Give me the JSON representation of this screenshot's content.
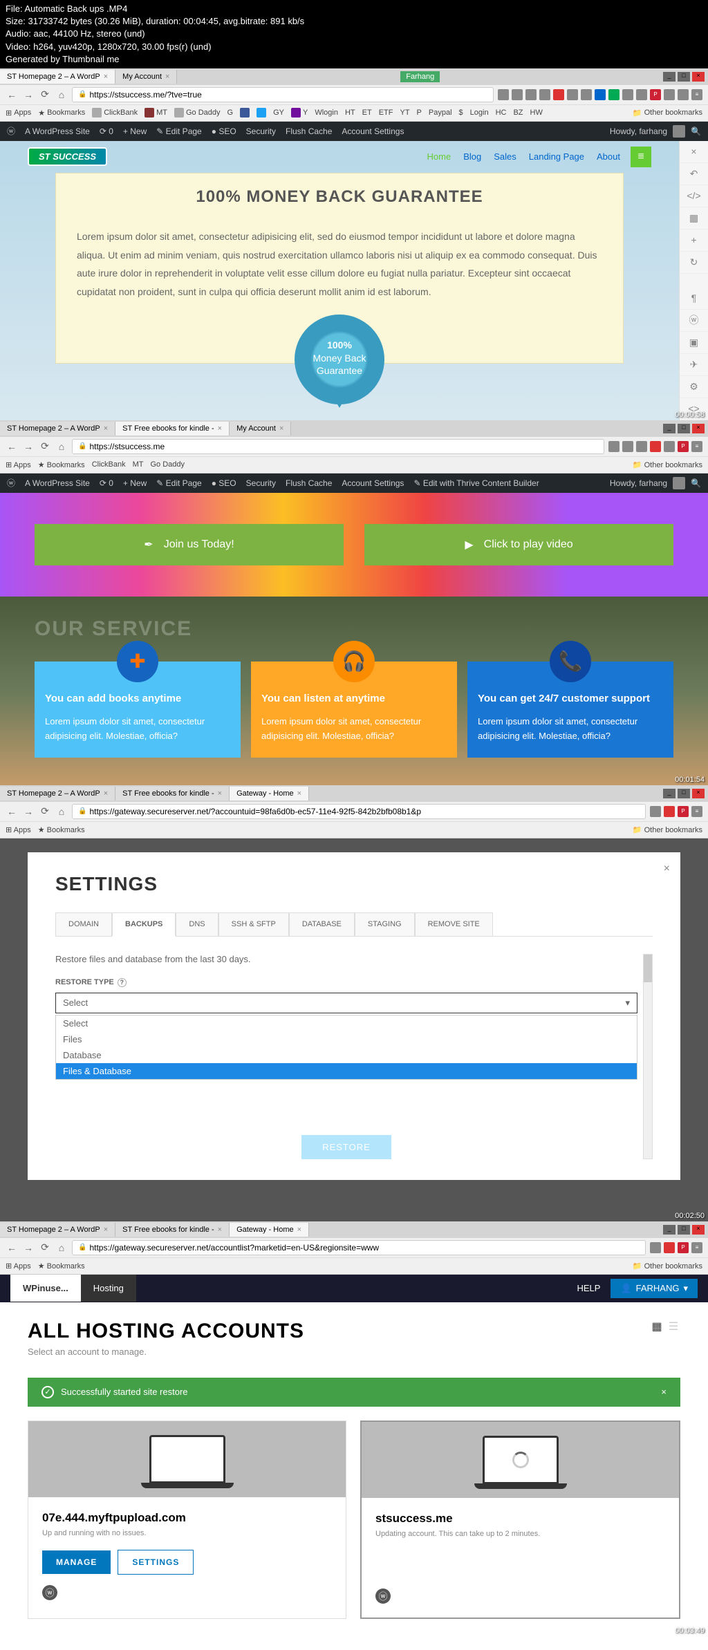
{
  "video_meta": {
    "file": "File: Automatic Back ups .MP4",
    "size": "Size: 31733742 bytes (30.26 MiB), duration: 00:04:45, avg.bitrate: 891 kb/s",
    "audio": "Audio: aac, 44100 Hz, stereo (und)",
    "video": "Video: h264, yuv420p, 1280x720, 30.00 fps(r) (und)",
    "gen": "Generated by Thumbnail me"
  },
  "screen1": {
    "tabs": [
      {
        "label": "ST Homepage 2 – A WordP"
      },
      {
        "label": "My Account"
      }
    ],
    "url": "https://stsuccess.me/?tve=true",
    "window_title": "Farhang",
    "bookmarks": [
      "Apps",
      "Bookmarks",
      "ClickBank",
      "MT",
      "Go Daddy",
      "G",
      "f",
      "t",
      "GY",
      "Y",
      "Wlogin",
      "HT",
      "ET",
      "ETF",
      "YT",
      "P",
      "Paypal",
      "$",
      "Login",
      "HC",
      "BZ",
      "HW",
      "Other bookmarks"
    ],
    "wp_bar": {
      "site": "A WordPress Site",
      "updates": "0",
      "new": "New",
      "edit": "Edit Page",
      "seo": "SEO",
      "security": "Security",
      "cache": "Flush Cache",
      "account": "Account Settings",
      "howdy": "Howdy, farhang"
    },
    "logo": "ST SUCCESS",
    "nav": [
      "Home",
      "Blog",
      "Sales",
      "Landing Page",
      "About"
    ],
    "guarantee": {
      "title": "100% MONEY BACK GUARANTEE",
      "text": "Lorem ipsum dolor sit amet, consectetur adipisicing elit, sed do eiusmod tempor incididunt ut labore et dolore magna aliqua. Ut enim ad minim veniam, quis nostrud exercitation ullamco laboris nisi ut aliquip ex ea commodo consequat. Duis aute irure dolor in reprehenderit in voluptate velit esse cillum dolore eu fugiat nulla pariatur. Excepteur sint occaecat cupidatat non proident, sunt in culpa qui officia deserunt mollit anim id est laborum.",
      "badge_line1": "100%",
      "badge_line2": "Money Back",
      "badge_line3": "Guarantee"
    },
    "timestamp": "00:00:58"
  },
  "screen2": {
    "tabs": [
      {
        "label": "ST Homepage 2 – A WordP"
      },
      {
        "label": "ST Free ebooks for kindle -"
      },
      {
        "label": "My Account"
      }
    ],
    "url": "https://stsuccess.me",
    "wp_bar": {
      "site": "A WordPress Site",
      "new": "New",
      "edit": "Edit Page",
      "seo": "SEO",
      "security": "Security",
      "cache": "Flush Cache",
      "account": "Account Settings",
      "thrive": "Edit with Thrive Content Builder",
      "howdy": "Howdy, farhang"
    },
    "hero_btn1": "Join us Today!",
    "hero_btn2": "Click to play video",
    "services_title": "OUR SERVICE",
    "cards": [
      {
        "title": "You can add books anytime",
        "text": "Lorem ipsum dolor sit amet, consectetur adipisicing elit. Molestiae, officia?"
      },
      {
        "title": "You can listen at anytime",
        "text": "Lorem ipsum dolor sit amet, consectetur adipisicing elit. Molestiae, officia?"
      },
      {
        "title": "You can get 24/7 customer support",
        "text": "Lorem ipsum dolor sit amet, consectetur adipisicing elit. Molestiae, officia?"
      }
    ],
    "timestamp": "00:01:54"
  },
  "screen3": {
    "tabs": [
      {
        "label": "ST Homepage 2 – A WordP"
      },
      {
        "label": "ST Free ebooks for kindle -"
      },
      {
        "label": "Gateway - Home"
      }
    ],
    "url": "https://gateway.secureserver.net/?accountuid=98fa6d0b-ec57-11e4-92f5-842b2bfb08b1&p",
    "modal": {
      "title": "SETTINGS",
      "tabs": [
        "DOMAIN",
        "BACKUPS",
        "DNS",
        "SSH & SFTP",
        "DATABASE",
        "STAGING",
        "REMOVE SITE"
      ],
      "active_tab": 1,
      "restore_desc": "Restore files and database from the last 30 days.",
      "restore_label": "RESTORE TYPE",
      "select_value": "Select",
      "options": [
        "Select",
        "Files",
        "Database",
        "Files & Database"
      ],
      "restore_btn": "RESTORE"
    },
    "timestamp": "00:02:50"
  },
  "screen4": {
    "tabs": [
      {
        "label": "ST Homepage 2 – A WordP"
      },
      {
        "label": "ST Free ebooks for kindle -"
      },
      {
        "label": "Gateway - Home"
      }
    ],
    "url": "https://gateway.secureserver.net/accountlist?marketid=en-US&regionsite=www",
    "header": {
      "item1": "WPinuse...",
      "item2": "Hosting",
      "help": "HELP",
      "user": "FARHANG"
    },
    "title": "ALL HOSTING ACCOUNTS",
    "subtitle": "Select an account to manage.",
    "banner": "Successfully started site restore",
    "accounts": [
      {
        "domain": "07e.444.myftpupload.com",
        "status": "Up and running with no issues.",
        "manage": "MANAGE",
        "settings": "SETTINGS"
      },
      {
        "domain": "stsuccess.me",
        "status": "Updating account. This can take up to 2 minutes."
      }
    ],
    "timestamp": "00:03:49"
  }
}
